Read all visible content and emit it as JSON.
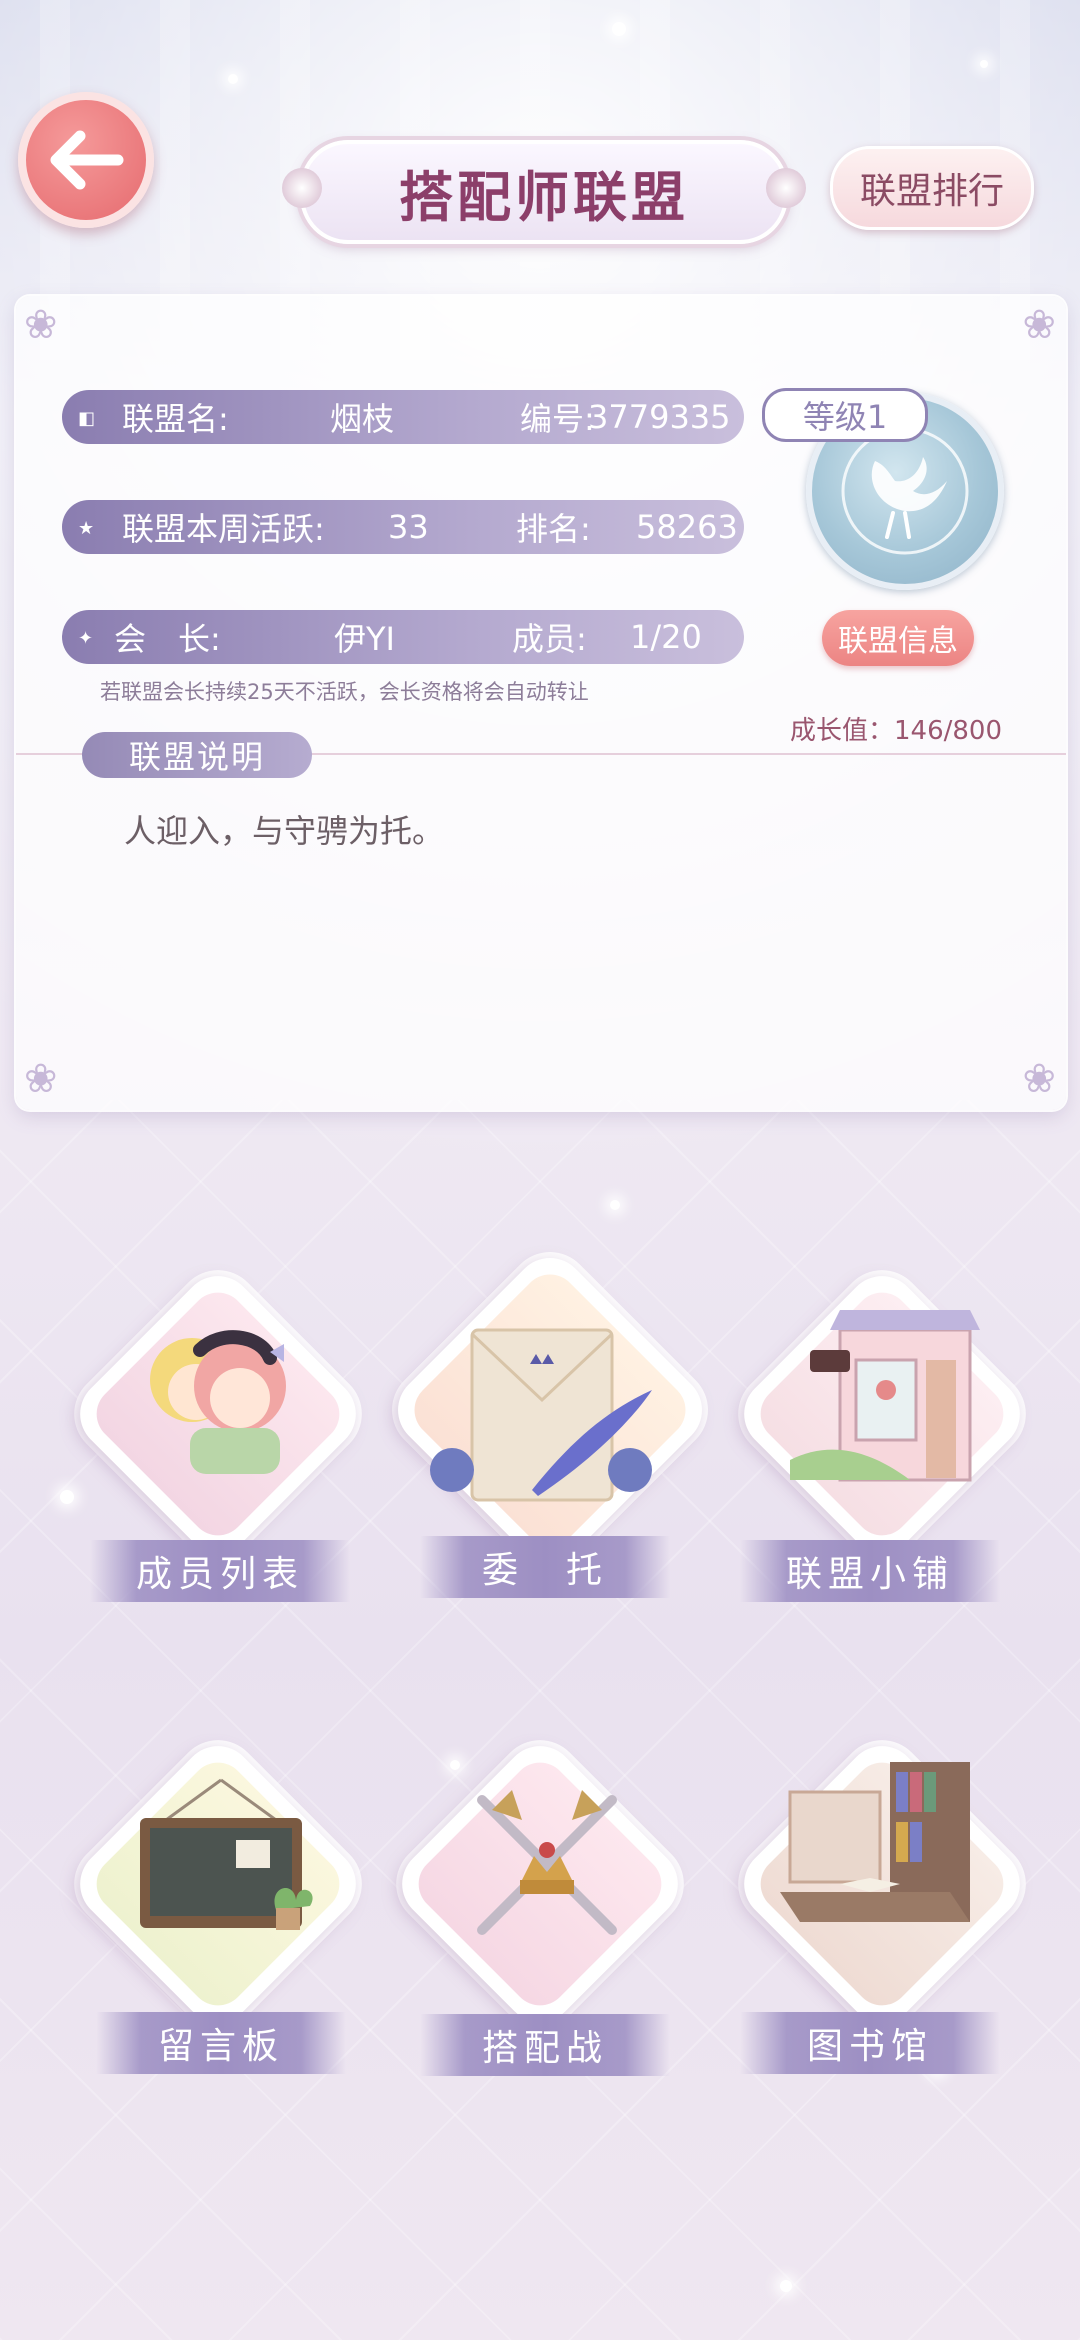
{
  "header": {
    "back_icon": "arrow-left-icon",
    "title": "搭配师联盟",
    "rank_button": "联盟排行"
  },
  "alliance": {
    "name_label": "联盟名:",
    "name": "烟枝",
    "id_label": "编号:",
    "id": "3779335",
    "activity_label": "联盟本周活跃:",
    "activity": "33",
    "rank_label": "排名:",
    "rank": "58263",
    "leader_label": "会　长:",
    "leader": "伊YI",
    "members_label": "成员:",
    "members": "1/20",
    "level": "等级1",
    "info_button": "联盟信息",
    "notice": "若联盟会长持续25天不活跃，会长资格将会自动转让",
    "growth": "成长值：146/800",
    "desc_label": "联盟说明",
    "desc_text": "人迎入，与守骋为托。"
  },
  "features": [
    {
      "label": "成员列表",
      "icon": "members-illustration"
    },
    {
      "label": "委　托",
      "icon": "letter-quill-illustration"
    },
    {
      "label": "联盟小铺",
      "icon": "shop-illustration"
    },
    {
      "label": "留言板",
      "icon": "chalkboard-illustration"
    },
    {
      "label": "搭配战",
      "icon": "crossed-swords-illustration"
    },
    {
      "label": "图书馆",
      "icon": "library-illustration"
    }
  ],
  "colors": {
    "accent": "#8c3f6a",
    "row": "#8a7db0",
    "button": "#ec8483"
  }
}
